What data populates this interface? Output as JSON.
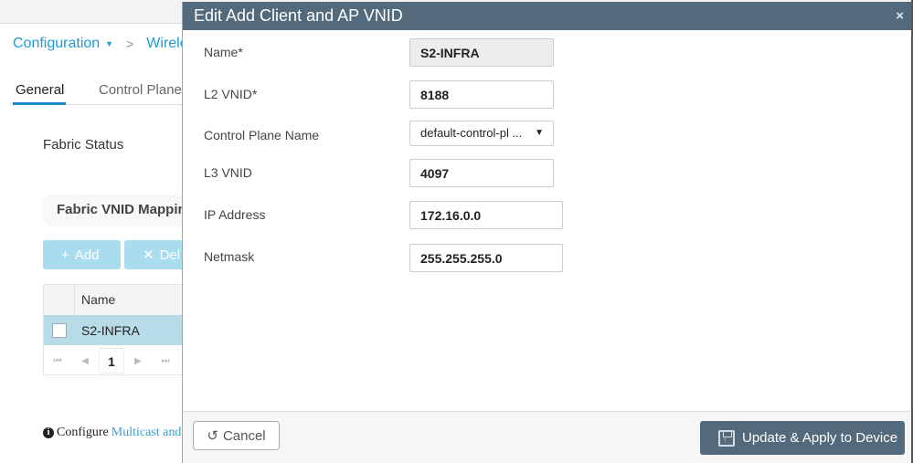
{
  "background": {
    "breadcrumb": {
      "root": "Configuration",
      "current": "Wireles"
    },
    "tabs": [
      {
        "label": "General",
        "active": true
      },
      {
        "label": "Control Plane",
        "active": false
      }
    ],
    "fabric_status_label": "Fabric Status",
    "vnid_panel_title": "Fabric VNID Mappin",
    "buttons": {
      "add": "Add",
      "delete": "Del"
    },
    "grid": {
      "column_header": "Name",
      "rows": [
        {
          "name": "S2-INFRA",
          "selected": true
        }
      ],
      "pager": {
        "first": "⏮",
        "prev": "◀",
        "page": "1",
        "next": "▶",
        "last": "⏭"
      }
    },
    "footnote": {
      "prefix": "Configure",
      "link": "Multicast and IG"
    }
  },
  "modal": {
    "title": "Edit Add Client and AP VNID",
    "close_icon": "×",
    "fields": [
      {
        "label": "Name*",
        "value": "S2-INFRA",
        "readonly": true
      },
      {
        "label": "L2 VNID*",
        "value": "8188"
      },
      {
        "label": "Control Plane Name",
        "value": "default-control-pl ...",
        "type": "select"
      },
      {
        "label": "L3 VNID",
        "value": "4097"
      },
      {
        "label": "IP Address",
        "value": "172.16.0.0"
      },
      {
        "label": "Netmask",
        "value": "255.255.255.0"
      }
    ],
    "footer": {
      "cancel": "Cancel",
      "update": "Update & Apply to Device"
    }
  },
  "colors": {
    "accent": "#1e9bd7",
    "modal_header": "#526a7c",
    "selected_row": "#b7dbe7"
  }
}
